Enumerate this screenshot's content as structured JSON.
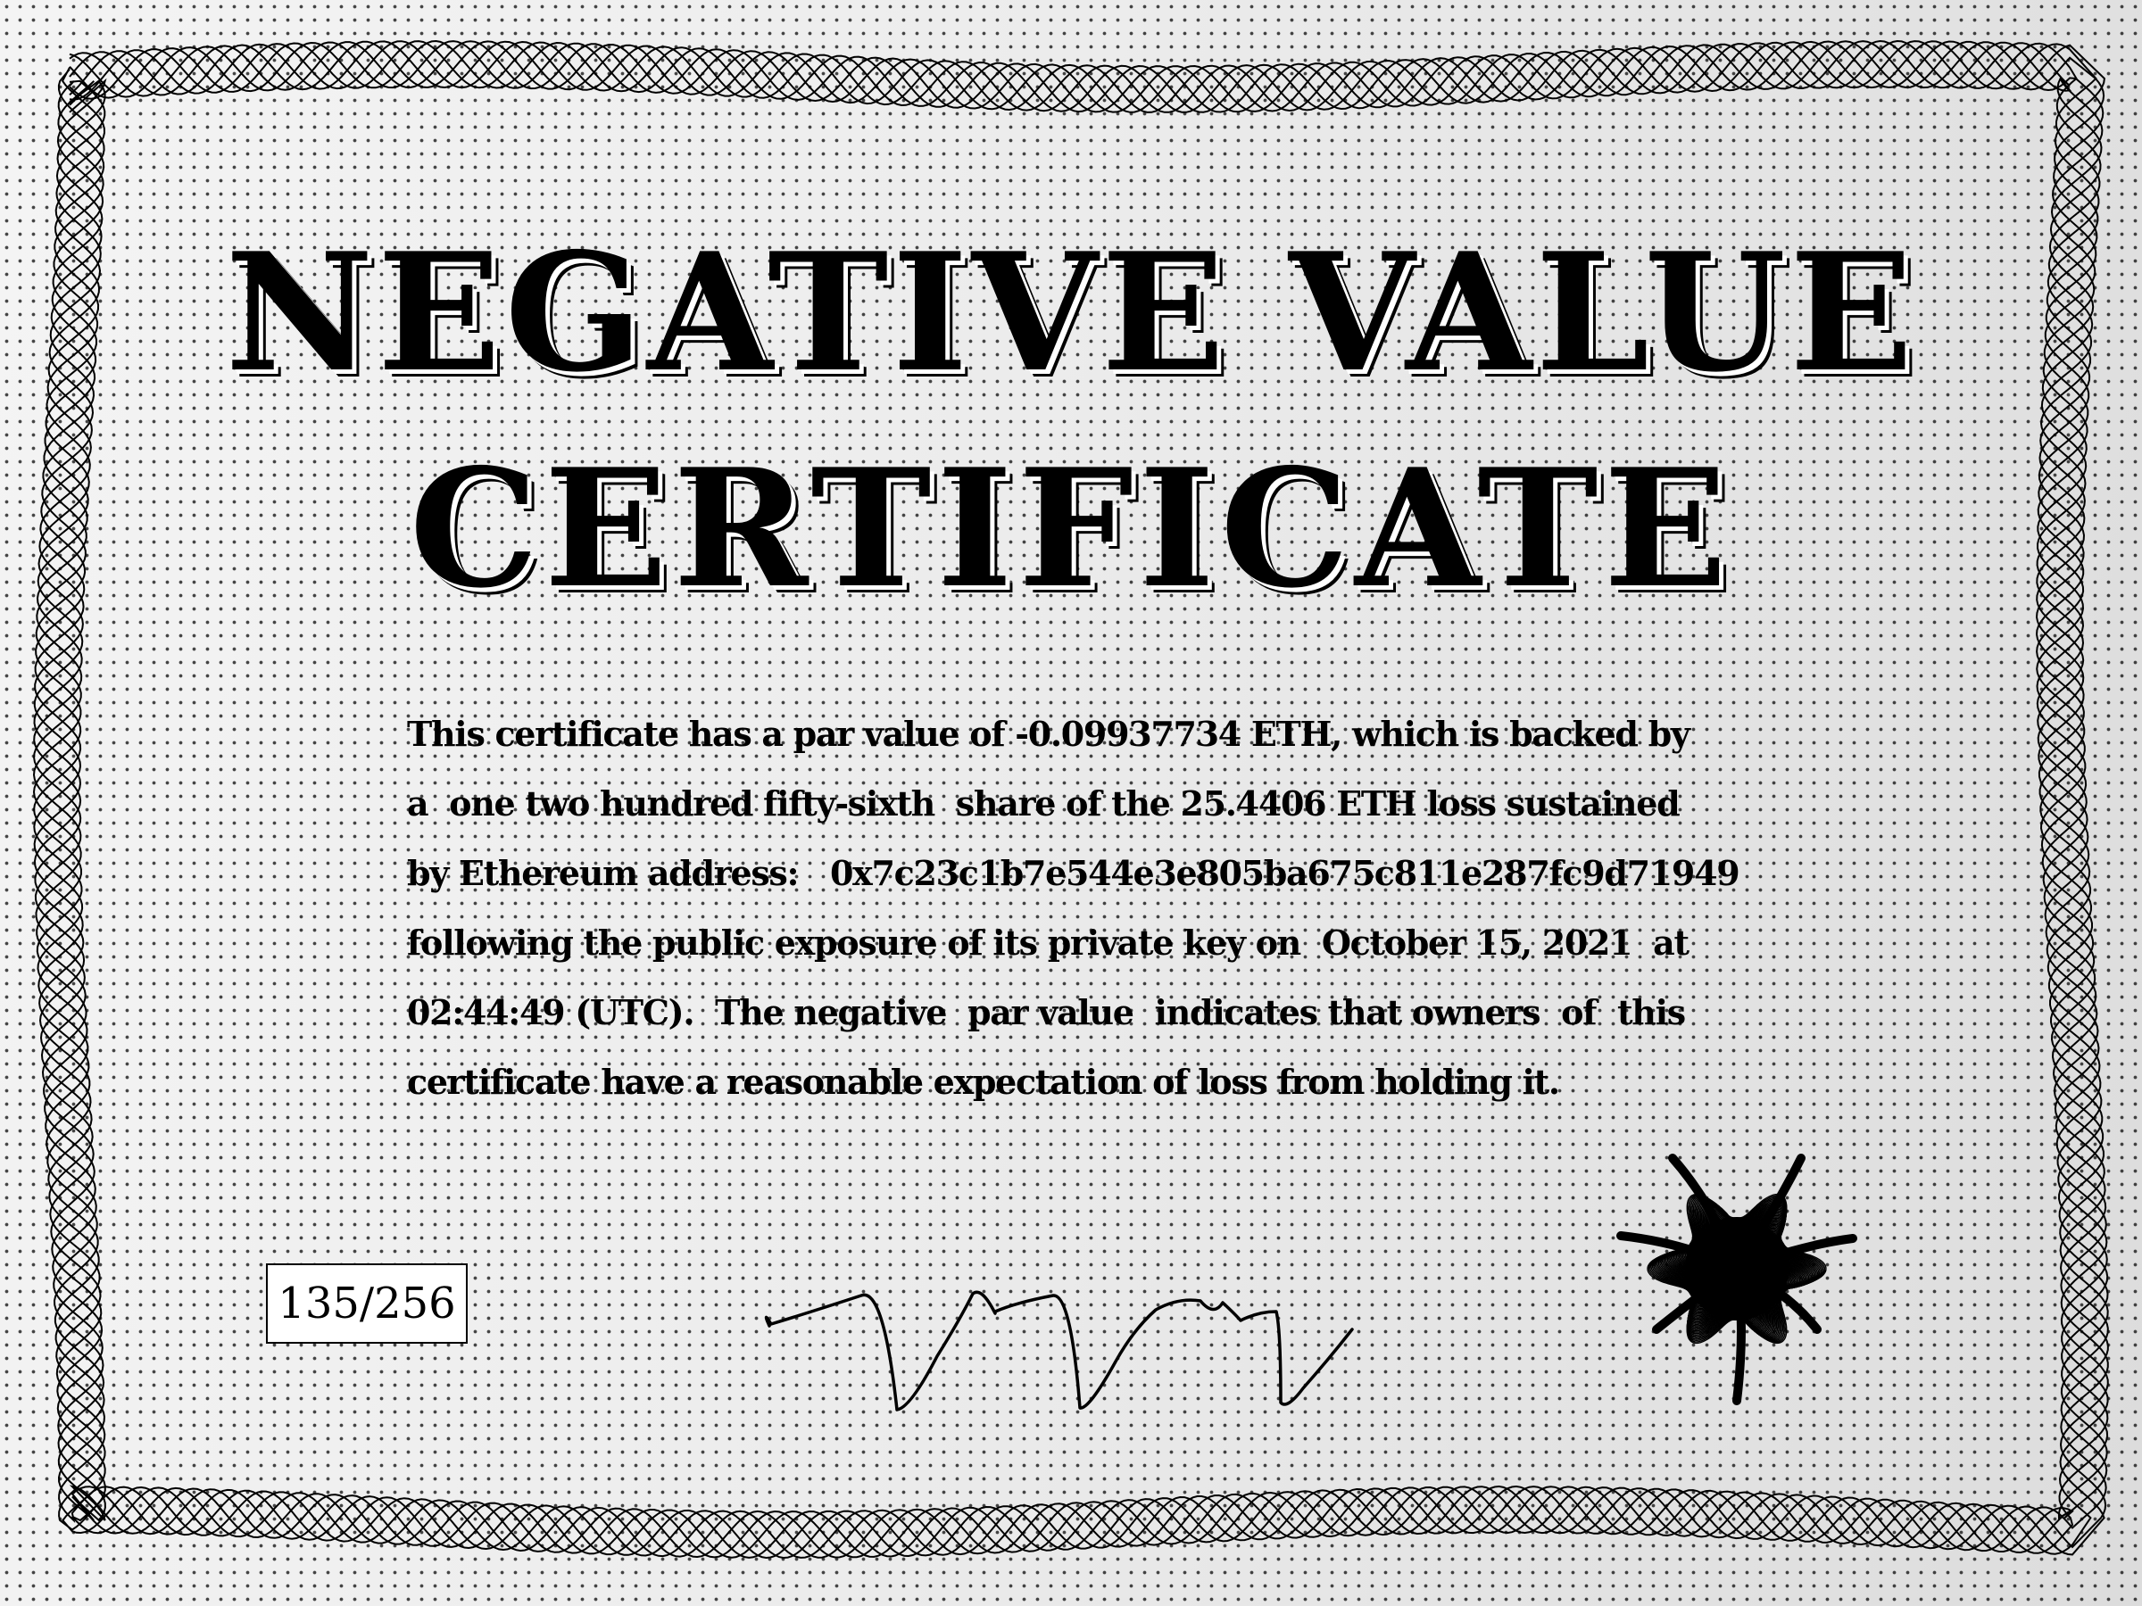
{
  "certificate": {
    "title_line_1": "NEGATIVE VALUE",
    "title_line_2": "CERTIFICATE",
    "body_lines": [
      "This certificate has a par value of -0.09937734 ETH, which is backed by",
      "a  one two hundred fifty-sixth  share of the 25.4406 ETH loss sustained",
      "by Ethereum address:   0x7c23c1b7e544e3e805ba675c811e287fc9d71949",
      "following the public exposure of its private key on  October 15, 2021  at",
      "02:44:49 (UTC).  The negative  par value  indicates that owners  of  this",
      "certificate have a reasonable expectation of loss from holding it."
    ],
    "serial_number": "135/256"
  },
  "colors": {
    "ink": "#000000",
    "paper": "#ececec"
  }
}
